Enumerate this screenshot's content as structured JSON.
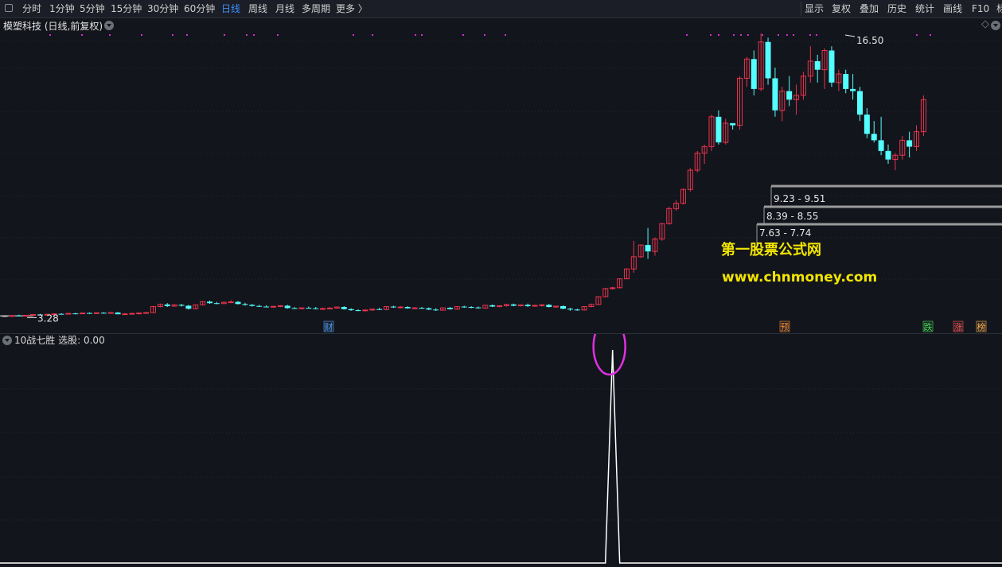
{
  "toolbar": {
    "periods": [
      {
        "label": "分时",
        "active": false
      },
      {
        "label": "1分钟",
        "active": false
      },
      {
        "label": "5分钟",
        "active": false
      },
      {
        "label": "15分钟",
        "active": false
      },
      {
        "label": "30分钟",
        "active": false
      },
      {
        "label": "60分钟",
        "active": false
      },
      {
        "label": "日线",
        "active": true
      },
      {
        "label": "周线",
        "active": false
      },
      {
        "label": "月线",
        "active": false
      },
      {
        "label": "多周期",
        "active": false
      },
      {
        "label": "更多 〉",
        "active": false
      }
    ],
    "actions": [
      "显示",
      "复权",
      "叠加",
      "历史",
      "统计",
      "画线",
      "F10",
      "标"
    ]
  },
  "stock": {
    "name": "模塑科技",
    "mode": "(日线,前复权)"
  },
  "main_chart": {
    "high_label": "16.50",
    "low_label": "3.28",
    "zones": [
      {
        "label": "9.23 - 9.51"
      },
      {
        "label": "8.39 - 8.55"
      },
      {
        "label": "7.63 - 7.74"
      }
    ],
    "markers": [
      {
        "char": "财",
        "color": "#4aa3ff"
      },
      {
        "char": "预",
        "color": "#ff8a2a"
      },
      {
        "char": "跌",
        "color": "#3fe04f"
      },
      {
        "char": "涨",
        "color": "#ff4d4d"
      },
      {
        "char": "榜",
        "color": "#ffb040"
      }
    ],
    "watermark_cn": "第一股票公式网",
    "watermark_url": "www.chnmoney.com",
    "up_color": "#e8344e",
    "down_color": "#54ffff"
  },
  "sub_chart": {
    "indicator_name": "10战七胜",
    "select_label": "选股:",
    "select_value": "0.00",
    "signal_bar_index": 86,
    "highlight_color": "#e030e0"
  },
  "candles": [
    [
      3.28,
      3.31,
      3.25,
      3.28
    ],
    [
      3.28,
      3.33,
      3.24,
      3.3
    ],
    [
      3.3,
      3.34,
      3.27,
      3.29
    ],
    [
      3.29,
      3.32,
      3.26,
      3.31
    ],
    [
      3.31,
      3.36,
      3.29,
      3.35
    ],
    [
      3.35,
      3.38,
      3.3,
      3.32
    ],
    [
      3.32,
      3.37,
      3.3,
      3.36
    ],
    [
      3.36,
      3.4,
      3.33,
      3.38
    ],
    [
      3.38,
      3.41,
      3.34,
      3.37
    ],
    [
      3.37,
      3.42,
      3.35,
      3.4
    ],
    [
      3.4,
      3.43,
      3.36,
      3.39
    ],
    [
      3.39,
      3.43,
      3.37,
      3.42
    ],
    [
      3.42,
      3.45,
      3.38,
      3.4
    ],
    [
      3.4,
      3.44,
      3.37,
      3.43
    ],
    [
      3.43,
      3.46,
      3.39,
      3.41
    ],
    [
      3.41,
      3.45,
      3.38,
      3.44
    ],
    [
      3.44,
      3.47,
      3.4,
      3.36
    ],
    [
      3.36,
      3.42,
      3.33,
      3.38
    ],
    [
      3.38,
      3.43,
      3.35,
      3.4
    ],
    [
      3.4,
      3.44,
      3.36,
      3.42
    ],
    [
      3.42,
      3.46,
      3.38,
      3.44
    ],
    [
      3.44,
      3.75,
      3.43,
      3.72
    ],
    [
      3.72,
      3.86,
      3.68,
      3.82
    ],
    [
      3.82,
      3.88,
      3.7,
      3.74
    ],
    [
      3.74,
      3.84,
      3.71,
      3.8
    ],
    [
      3.8,
      3.85,
      3.72,
      3.76
    ],
    [
      3.76,
      3.8,
      3.58,
      3.62
    ],
    [
      3.62,
      3.82,
      3.6,
      3.8
    ],
    [
      3.8,
      3.98,
      3.78,
      3.95
    ],
    [
      3.95,
      4.0,
      3.85,
      3.88
    ],
    [
      3.88,
      3.94,
      3.83,
      3.86
    ],
    [
      3.86,
      3.96,
      3.84,
      3.92
    ],
    [
      3.92,
      4.02,
      3.9,
      3.94
    ],
    [
      3.94,
      3.98,
      3.82,
      3.84
    ],
    [
      3.84,
      3.9,
      3.76,
      3.8
    ],
    [
      3.8,
      3.84,
      3.72,
      3.75
    ],
    [
      3.75,
      3.8,
      3.7,
      3.72
    ],
    [
      3.72,
      3.78,
      3.68,
      3.7
    ],
    [
      3.7,
      3.76,
      3.67,
      3.73
    ],
    [
      3.73,
      3.79,
      3.69,
      3.76
    ],
    [
      3.76,
      3.8,
      3.62,
      3.65
    ],
    [
      3.65,
      3.7,
      3.61,
      3.63
    ],
    [
      3.63,
      3.68,
      3.59,
      3.66
    ],
    [
      3.66,
      3.72,
      3.62,
      3.64
    ],
    [
      3.64,
      3.7,
      3.6,
      3.61
    ],
    [
      3.61,
      3.66,
      3.57,
      3.63
    ],
    [
      3.63,
      3.69,
      3.6,
      3.65
    ],
    [
      3.65,
      3.72,
      3.62,
      3.7
    ],
    [
      3.7,
      3.74,
      3.58,
      3.6
    ],
    [
      3.6,
      3.64,
      3.52,
      3.55
    ],
    [
      3.55,
      3.6,
      3.5,
      3.53
    ],
    [
      3.53,
      3.58,
      3.49,
      3.56
    ],
    [
      3.56,
      3.62,
      3.52,
      3.6
    ],
    [
      3.6,
      3.66,
      3.56,
      3.58
    ],
    [
      3.58,
      3.74,
      3.56,
      3.72
    ],
    [
      3.72,
      3.76,
      3.66,
      3.68
    ],
    [
      3.68,
      3.74,
      3.64,
      3.7
    ],
    [
      3.7,
      3.74,
      3.62,
      3.64
    ],
    [
      3.64,
      3.7,
      3.6,
      3.66
    ],
    [
      3.66,
      3.7,
      3.62,
      3.64
    ],
    [
      3.64,
      3.68,
      3.56,
      3.58
    ],
    [
      3.58,
      3.64,
      3.52,
      3.55
    ],
    [
      3.55,
      3.68,
      3.53,
      3.66
    ],
    [
      3.66,
      3.7,
      3.58,
      3.6
    ],
    [
      3.6,
      3.74,
      3.58,
      3.72
    ],
    [
      3.72,
      3.76,
      3.66,
      3.7
    ],
    [
      3.7,
      3.74,
      3.64,
      3.68
    ],
    [
      3.68,
      3.72,
      3.62,
      3.65
    ],
    [
      3.65,
      3.8,
      3.63,
      3.78
    ],
    [
      3.78,
      3.82,
      3.7,
      3.72
    ],
    [
      3.72,
      3.78,
      3.68,
      3.76
    ],
    [
      3.76,
      3.84,
      3.72,
      3.82
    ],
    [
      3.82,
      3.86,
      3.74,
      3.76
    ],
    [
      3.76,
      3.82,
      3.72,
      3.8
    ],
    [
      3.8,
      3.86,
      3.7,
      3.74
    ],
    [
      3.74,
      3.8,
      3.7,
      3.78
    ],
    [
      3.78,
      3.84,
      3.72,
      3.8
    ],
    [
      3.8,
      3.84,
      3.68,
      3.7
    ],
    [
      3.7,
      3.76,
      3.66,
      3.74
    ],
    [
      3.74,
      3.78,
      3.6,
      3.62
    ],
    [
      3.62,
      3.66,
      3.52,
      3.58
    ],
    [
      3.58,
      3.62,
      3.52,
      3.56
    ],
    [
      3.56,
      3.74,
      3.54,
      3.72
    ],
    [
      3.72,
      3.86,
      3.68,
      3.82
    ],
    [
      3.82,
      4.2,
      3.8,
      4.18
    ],
    [
      4.18,
      4.6,
      4.15,
      4.56
    ],
    [
      4.56,
      4.64,
      4.52,
      4.6
    ],
    [
      4.6,
      5.04,
      4.58,
      5.02
    ],
    [
      5.02,
      5.5,
      5.0,
      5.48
    ],
    [
      5.48,
      6.8,
      5.3,
      6.05
    ],
    [
      6.05,
      6.62,
      6.0,
      6.6
    ],
    [
      6.6,
      7.4,
      5.95,
      6.3
    ],
    [
      6.3,
      6.95,
      6.1,
      6.88
    ],
    [
      6.88,
      7.63,
      6.8,
      7.6
    ],
    [
      7.6,
      8.39,
      7.55,
      8.3
    ],
    [
      8.3,
      8.7,
      8.2,
      8.55
    ],
    [
      8.55,
      9.25,
      8.5,
      9.2
    ],
    [
      9.2,
      10.2,
      9.1,
      10.1
    ],
    [
      10.1,
      11.0,
      10.0,
      10.9
    ],
    [
      10.9,
      11.3,
      10.4,
      11.2
    ],
    [
      11.2,
      12.7,
      11.0,
      12.6
    ],
    [
      12.6,
      12.9,
      11.3,
      11.4
    ],
    [
      11.4,
      12.5,
      11.3,
      12.3
    ],
    [
      12.3,
      12.3,
      12.0,
      12.2
    ],
    [
      12.2,
      14.5,
      12.0,
      14.4
    ],
    [
      14.4,
      15.4,
      14.0,
      15.3
    ],
    [
      15.3,
      15.7,
      13.6,
      13.9
    ],
    [
      13.9,
      16.5,
      13.8,
      16.1
    ],
    [
      16.1,
      16.3,
      14.1,
      14.4
    ],
    [
      14.4,
      14.9,
      12.6,
      12.9
    ],
    [
      12.9,
      14.0,
      12.4,
      13.8
    ],
    [
      13.8,
      14.5,
      13.1,
      13.4
    ],
    [
      13.4,
      14.1,
      12.7,
      13.6
    ],
    [
      13.6,
      14.7,
      13.4,
      14.5
    ],
    [
      14.5,
      15.9,
      14.2,
      15.2
    ],
    [
      15.2,
      15.5,
      14.2,
      14.8
    ],
    [
      14.8,
      15.8,
      13.9,
      15.7
    ],
    [
      15.7,
      15.9,
      14.0,
      14.2
    ],
    [
      14.2,
      14.8,
      13.8,
      14.6
    ],
    [
      14.6,
      14.8,
      13.7,
      13.9
    ],
    [
      13.9,
      14.6,
      13.4,
      13.8
    ],
    [
      13.8,
      14.0,
      12.4,
      12.7
    ],
    [
      12.7,
      13.0,
      11.6,
      11.8
    ],
    [
      11.8,
      12.4,
      11.4,
      11.5
    ],
    [
      11.5,
      12.6,
      10.8,
      11.0
    ],
    [
      11.0,
      11.3,
      10.4,
      10.6
    ],
    [
      10.6,
      10.9,
      10.1,
      10.8
    ],
    [
      10.8,
      11.7,
      10.6,
      11.5
    ],
    [
      11.5,
      11.9,
      10.7,
      11.2
    ],
    [
      11.2,
      12.2,
      11.0,
      11.9
    ],
    [
      11.9,
      13.6,
      11.7,
      13.4
    ]
  ]
}
